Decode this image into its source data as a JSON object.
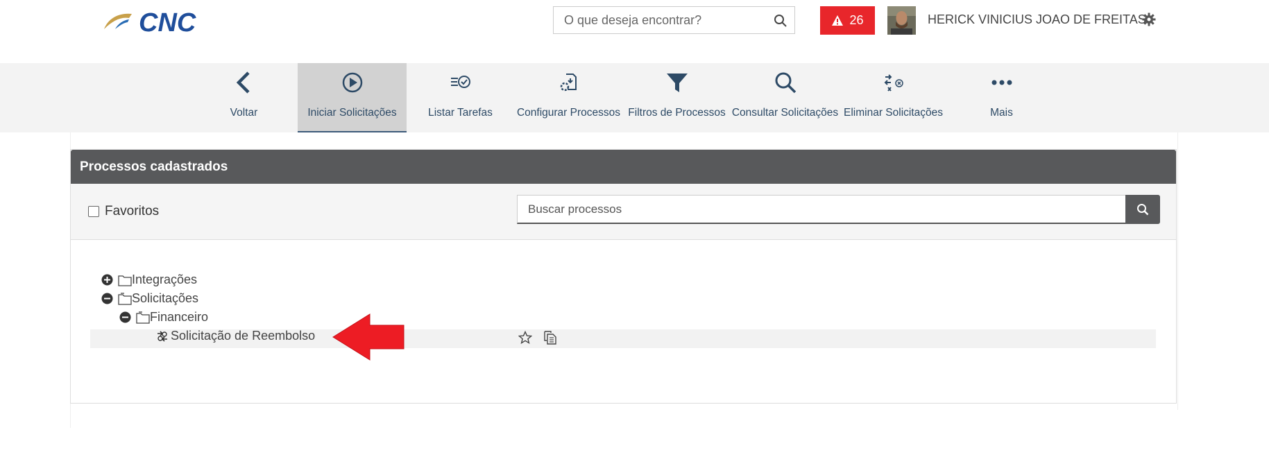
{
  "header": {
    "logo_text": "CNC",
    "search_placeholder": "O que deseja encontrar?",
    "alert_count": "26",
    "user_name": "HERICK VINICIUS JOAO DE FREITAS"
  },
  "toolbar": {
    "items": [
      {
        "label": "Voltar",
        "icon": "chevron-left-icon",
        "active": false
      },
      {
        "label": "Iniciar Solicitações",
        "icon": "play-circle-icon",
        "active": true
      },
      {
        "label": "Listar Tarefas",
        "icon": "task-list-icon",
        "active": false
      },
      {
        "label": "Configurar Processos",
        "icon": "process-config-icon",
        "active": false
      },
      {
        "label": "Filtros de Processos",
        "icon": "filter-icon",
        "active": false
      },
      {
        "label": "Consultar Solicitações",
        "icon": "search-icon",
        "active": false
      },
      {
        "label": "Eliminar Solicitações",
        "icon": "eliminate-icon",
        "active": false
      },
      {
        "label": "Mais",
        "icon": "more-icon",
        "active": false
      }
    ]
  },
  "panel": {
    "title": "Processos cadastrados",
    "favorites_label": "Favoritos",
    "search_placeholder": "Buscar processos"
  },
  "tree": {
    "integracoes": "Integrações",
    "solicitacoes": "Solicitações",
    "financeiro": "Financeiro",
    "reembolso": "Solicitação de Reembolso"
  },
  "colors": {
    "accent": "#2d4a66",
    "alert": "#e8262b",
    "panel_header": "#58595b",
    "arrow": "#ed1c24"
  }
}
